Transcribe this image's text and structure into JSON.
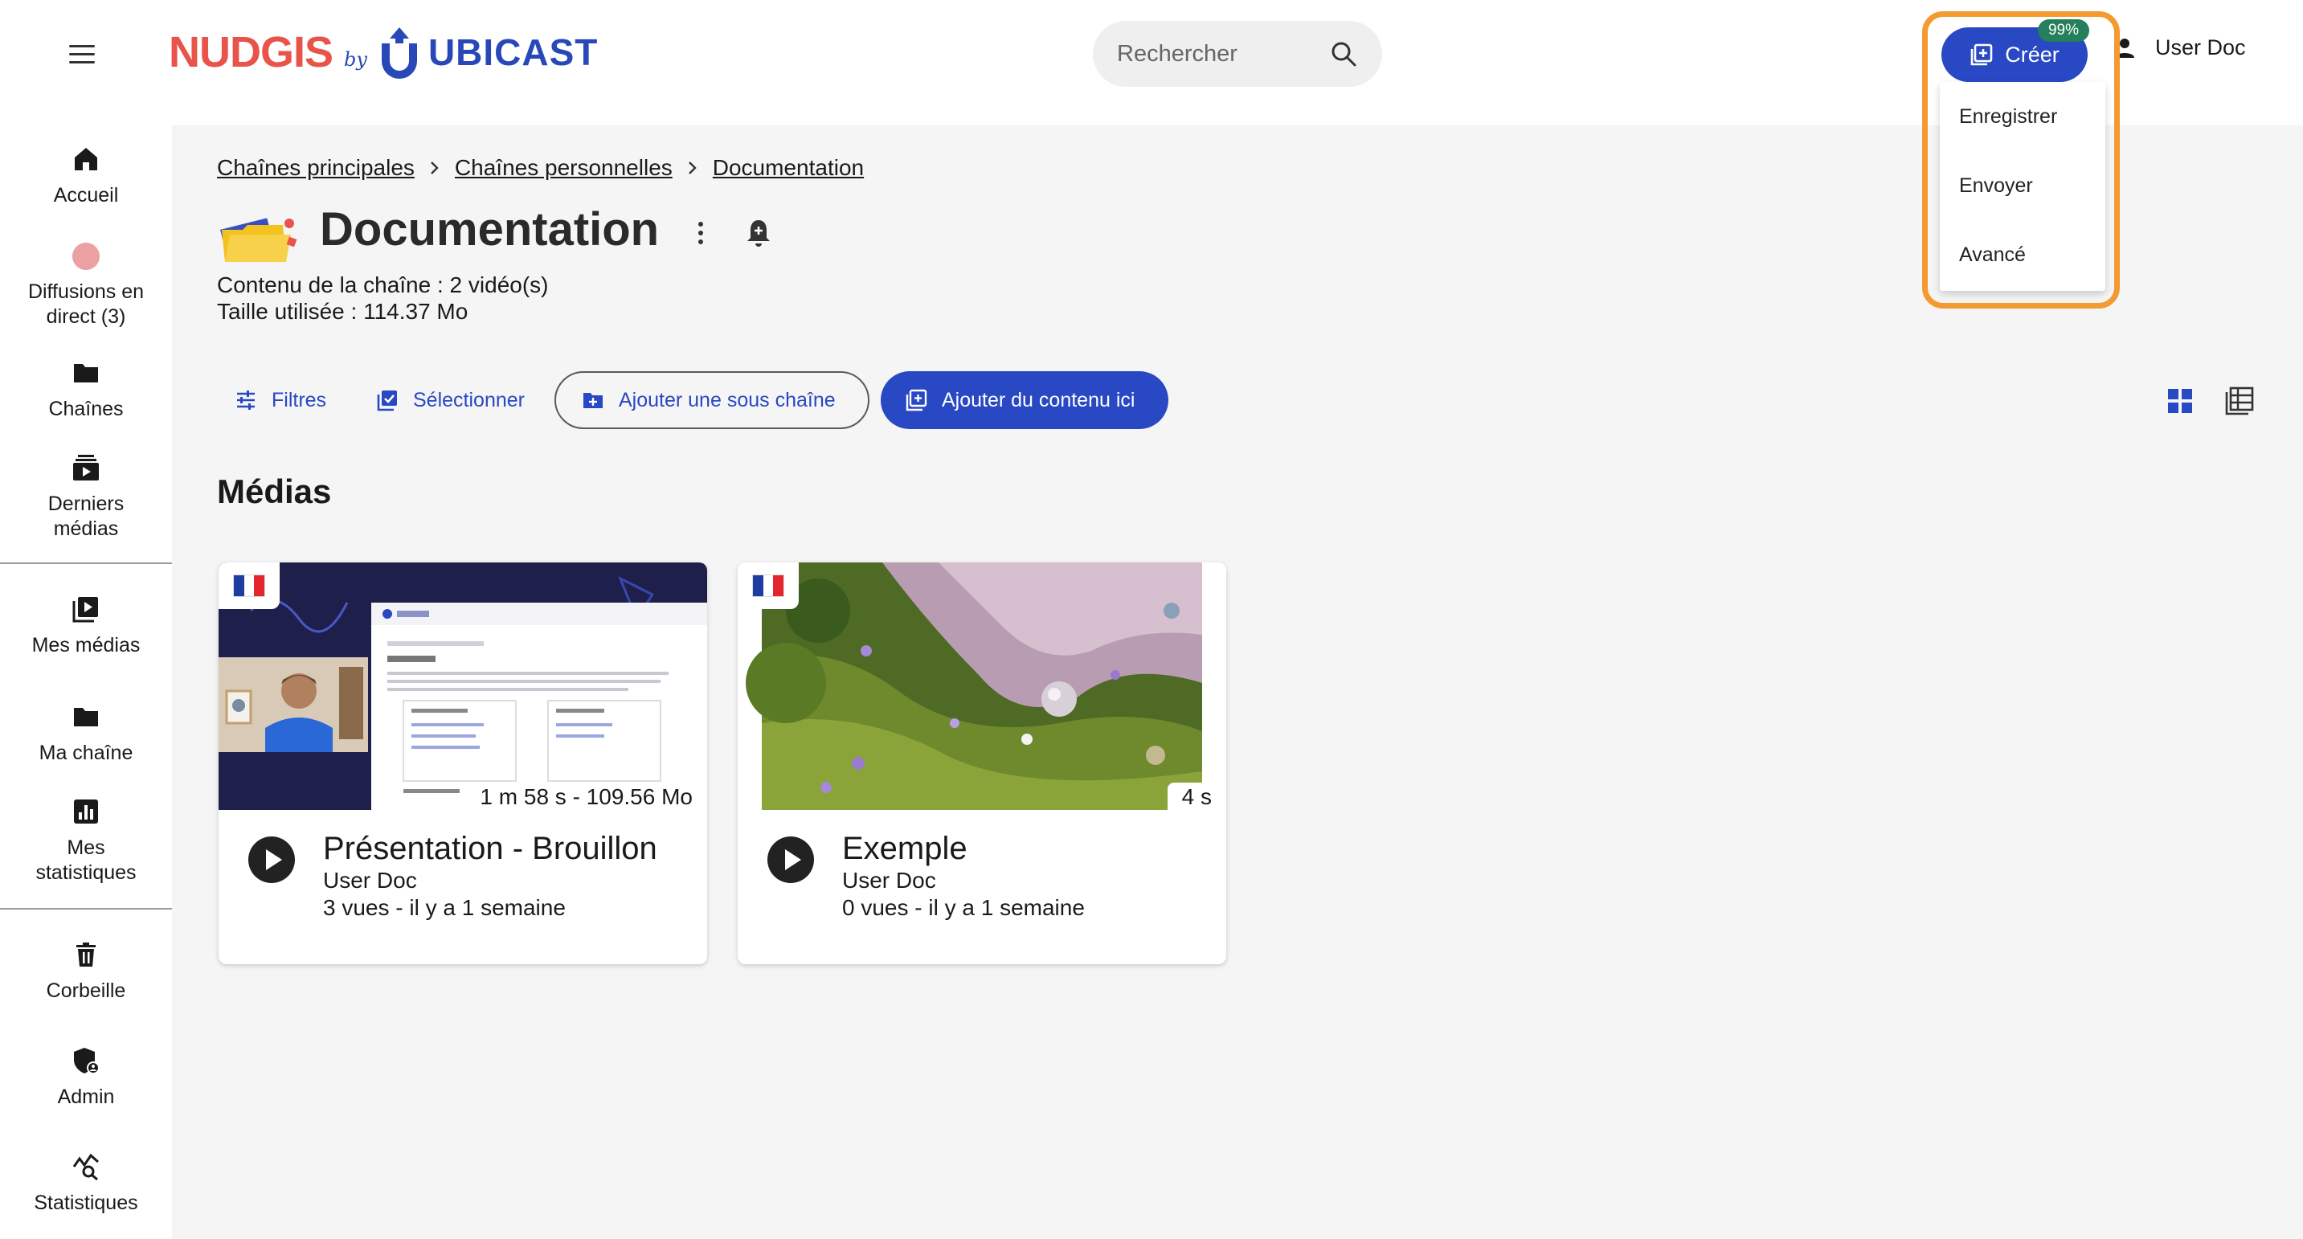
{
  "header": {
    "logo": {
      "brand": "NUDGIS",
      "by": "by",
      "company": "UBICAST"
    },
    "search": {
      "placeholder": "Rechercher"
    },
    "create": {
      "label": "Créer",
      "badge": "99%",
      "menu": [
        "Enregistrer",
        "Envoyer",
        "Avancé"
      ]
    },
    "user": {
      "name": "User Doc"
    }
  },
  "sidebar": {
    "items": [
      {
        "label": "Accueil",
        "icon": "home-icon"
      },
      {
        "label": "Diffusions en direct (3)",
        "icon": "live-dot-icon"
      },
      {
        "label": "Chaînes",
        "icon": "folder-icon"
      },
      {
        "label": "Derniers médias",
        "icon": "media-stack-icon"
      },
      {
        "label": "Mes médias",
        "icon": "my-media-icon"
      },
      {
        "label": "Ma chaîne",
        "icon": "folder-icon"
      },
      {
        "label": "Mes statistiques",
        "icon": "stats-icon"
      },
      {
        "label": "Corbeille",
        "icon": "trash-icon"
      },
      {
        "label": "Admin",
        "icon": "admin-shield-icon"
      },
      {
        "label": "Statistiques",
        "icon": "analytics-icon"
      }
    ]
  },
  "breadcrumb": [
    "Chaînes principales",
    "Chaînes personnelles",
    "Documentation"
  ],
  "channel": {
    "title": "Documentation",
    "content": "Contenu de la chaîne : 2 vidéo(s)",
    "size": "Taille utilisée : 114.37 Mo"
  },
  "toolbar": {
    "filters": "Filtres",
    "select": "Sélectionner",
    "add_subchannel": "Ajouter une sous chaîne",
    "add_content": "Ajouter du contenu ici"
  },
  "medias": {
    "section_title": "Médias",
    "items": [
      {
        "title": "Présentation - Brouillon",
        "author": "User Doc",
        "stats": "3 vues  - il y a 1 semaine",
        "duration": "1 m 58 s - 109.56 Mo",
        "language": "fr"
      },
      {
        "title": "Exemple",
        "author": "User Doc",
        "stats": "0 vues  - il y a 1 semaine",
        "duration": "4 s",
        "language": "fr"
      }
    ]
  },
  "colors": {
    "accent": "#2848c4",
    "brand_red": "#e8544a",
    "highlight": "#f39a30",
    "badge": "#257f5c"
  }
}
